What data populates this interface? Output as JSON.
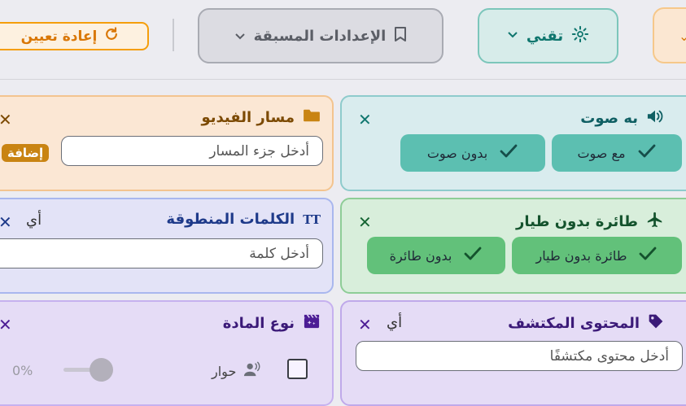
{
  "toolbar": {
    "tech_label": "تقني",
    "presets_label": "الإعدادات المسبقة",
    "reset_label": "إعادة تعيين"
  },
  "cards": {
    "sound": {
      "title": "به صوت",
      "options": [
        "مع صوت",
        "بدون صوت"
      ]
    },
    "drone": {
      "title": "طائرة بدون طيار",
      "options": [
        "طائرة بدون طيار",
        "بدون طائرة"
      ]
    },
    "content": {
      "title": "المحتوى المكتشف",
      "any_label": "أي",
      "placeholder": "أدخل محتوى مكتشفًا"
    },
    "path": {
      "title": "مسار الفيديو",
      "placeholder": "أدخل جزء المسار",
      "add_label": "إضافة"
    },
    "words": {
      "title": "الكلمات المنطوقة",
      "any_label": "أي",
      "placeholder": "أدخل كلمة"
    },
    "type": {
      "title": "نوع المادة",
      "option_label": "حوار",
      "slider_value": "0%"
    }
  },
  "colors": {
    "accent_orange": "#d97706",
    "teal": "#0f766e",
    "green": "#166534",
    "purple": "#4c1d95",
    "navy": "#1e3a8a"
  }
}
